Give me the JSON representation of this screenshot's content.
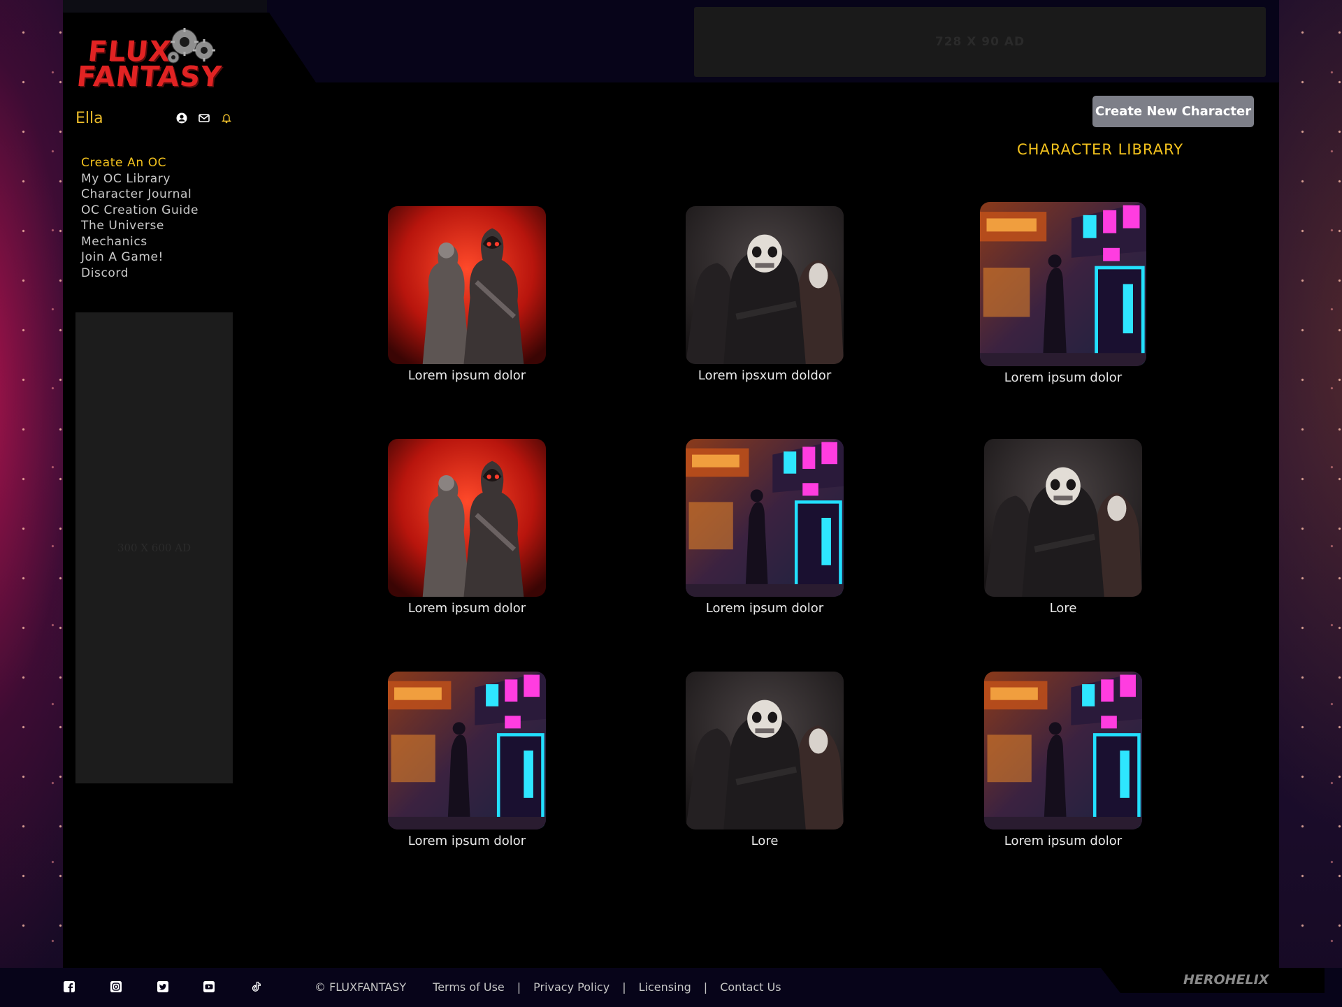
{
  "ads": {
    "banner_label": "728 X 90 AD",
    "sidebar_label": "300 X 600 AD"
  },
  "logo": {
    "line1": "FLUX",
    "line2": "FANTASY"
  },
  "user": {
    "name": "Ella"
  },
  "icons": {
    "profile": "user-circle-icon",
    "mail": "envelope-icon",
    "notifications": "bell-icon"
  },
  "nav": {
    "items": [
      {
        "label": "Create An OC",
        "active": true
      },
      {
        "label": "My OC Library"
      },
      {
        "label": "Character Journal"
      },
      {
        "label": "OC Creation Guide"
      },
      {
        "label": "The Universe"
      },
      {
        "label": "Mechanics"
      },
      {
        "label": "Join A Game!"
      },
      {
        "label": "Discord"
      }
    ]
  },
  "main": {
    "create_button_label": "Create New Character",
    "library_title": "CHARACTER LIBRARY",
    "characters": [
      {
        "caption": "Lorem ipsum dolor",
        "image": "red-hooded-soldiers"
      },
      {
        "caption": "Lorem ipsxum doldor",
        "image": "skull-mask-soldiers"
      },
      {
        "caption": "Lorem ipsum dolor",
        "image": "neon-city-street"
      },
      {
        "caption": "Lorem ipsum dolor",
        "image": "red-hooded-soldiers"
      },
      {
        "caption": "Lorem ipsum dolor",
        "image": "neon-city-street"
      },
      {
        "caption": "Lore",
        "image": "skull-mask-soldiers"
      },
      {
        "caption": "Lorem ipsum dolor",
        "image": "neon-city-street"
      },
      {
        "caption": "Lore",
        "image": "skull-mask-soldiers"
      },
      {
        "caption": "Lorem ipsum dolor",
        "image": "neon-city-street"
      }
    ]
  },
  "footer": {
    "social": [
      "facebook-icon",
      "instagram-icon",
      "twitter-icon",
      "youtube-icon",
      "tiktok-icon"
    ],
    "copyright": "© FLUXFANTASY",
    "links": [
      "Terms of Use",
      "Privacy Policy",
      "Licensing",
      "Contact Us"
    ],
    "separator": "|",
    "brand": "HEROHELIX"
  },
  "colors": {
    "accent": "#f3c21d",
    "logo_red": "#e12323",
    "button_gray": "#7d7f88",
    "background": "#000000"
  }
}
